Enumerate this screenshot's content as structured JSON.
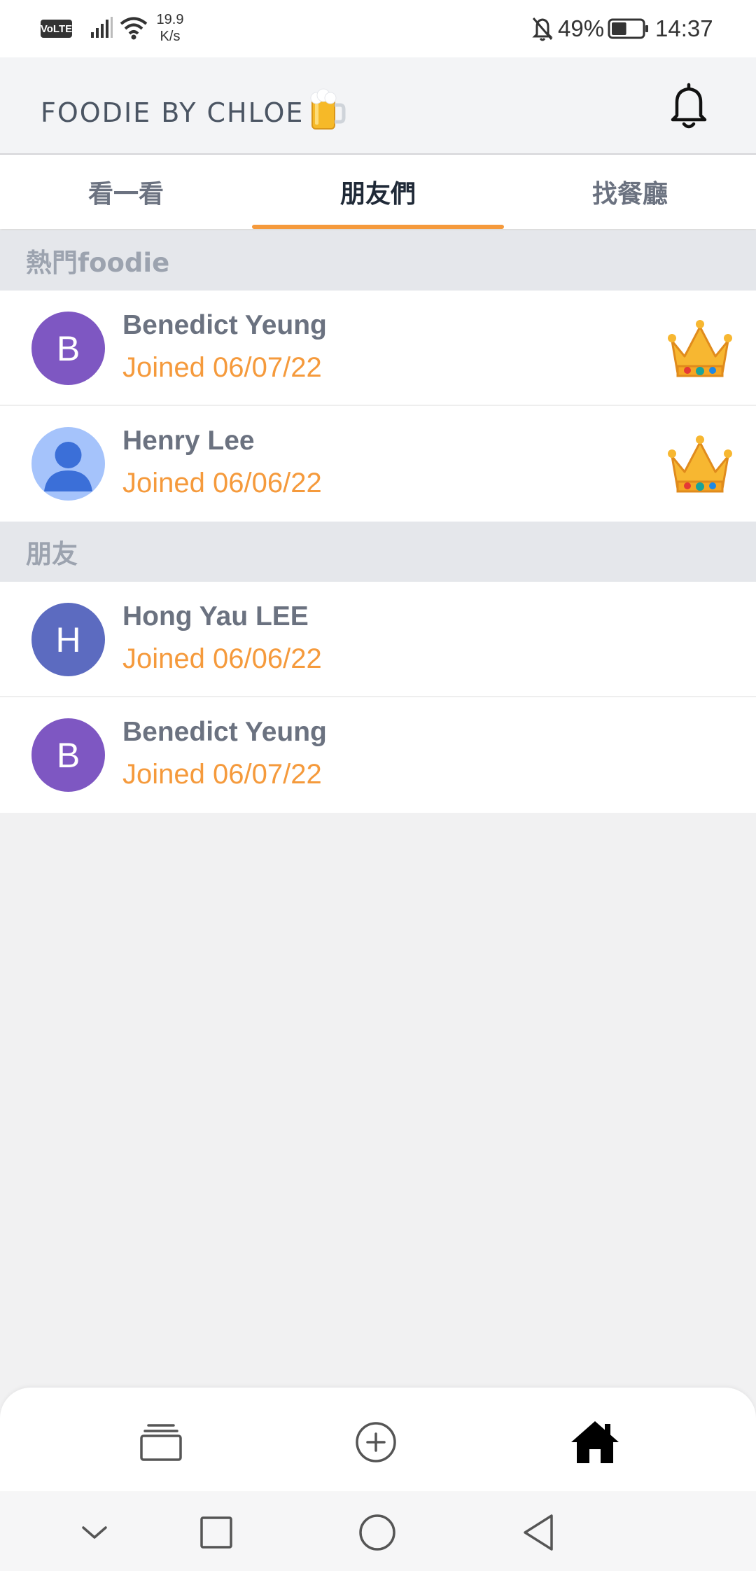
{
  "status_bar": {
    "network_badge": "VoLTE",
    "speed_value": "19.9",
    "speed_unit": "K/s",
    "battery_percent": "49%",
    "battery_level": 0.49,
    "time": "14:37"
  },
  "header": {
    "title": "FOODIE BY CHLOE",
    "logo_icon": "beer-mug-icon",
    "notification_icon": "bell-icon"
  },
  "tabs": [
    {
      "label": "看一看",
      "active": false
    },
    {
      "label": "朋友們",
      "active": true
    },
    {
      "label": "找餐廳",
      "active": false
    }
  ],
  "sections": {
    "popular": {
      "title": "熱門foodie",
      "items": [
        {
          "initial": "B",
          "name": "Benedict Yeung",
          "joined": "Joined 06/07/22",
          "avatar_color": "#7e57c2",
          "badge": "crown-icon"
        },
        {
          "initial": "",
          "name": "Henry Lee",
          "joined": "Joined 06/06/22",
          "avatar_color": "#a5c3fb",
          "avatar_icon": "person-icon",
          "badge": "crown-icon"
        }
      ]
    },
    "friends": {
      "title": "朋友",
      "items": [
        {
          "initial": "H",
          "name": "Hong Yau LEE",
          "joined": "Joined 06/06/22",
          "avatar_color": "#5c6bc0"
        },
        {
          "initial": "B",
          "name": "Benedict Yeung",
          "joined": "Joined 06/07/22",
          "avatar_color": "#7e57c2"
        }
      ]
    }
  },
  "bottom_nav": [
    {
      "icon": "cards-stack-icon"
    },
    {
      "icon": "add-circle-icon"
    },
    {
      "icon": "home-icon",
      "active": true
    }
  ],
  "system_nav": [
    {
      "icon": "chevron-down-icon"
    },
    {
      "icon": "recent-apps-icon"
    },
    {
      "icon": "home-circle-icon"
    },
    {
      "icon": "back-triangle-icon"
    }
  ],
  "colors": {
    "accent": "#f59a3c",
    "text_muted": "#6b7280",
    "section_bg": "#e5e7eb",
    "page_bg": "#f1f1f2"
  }
}
